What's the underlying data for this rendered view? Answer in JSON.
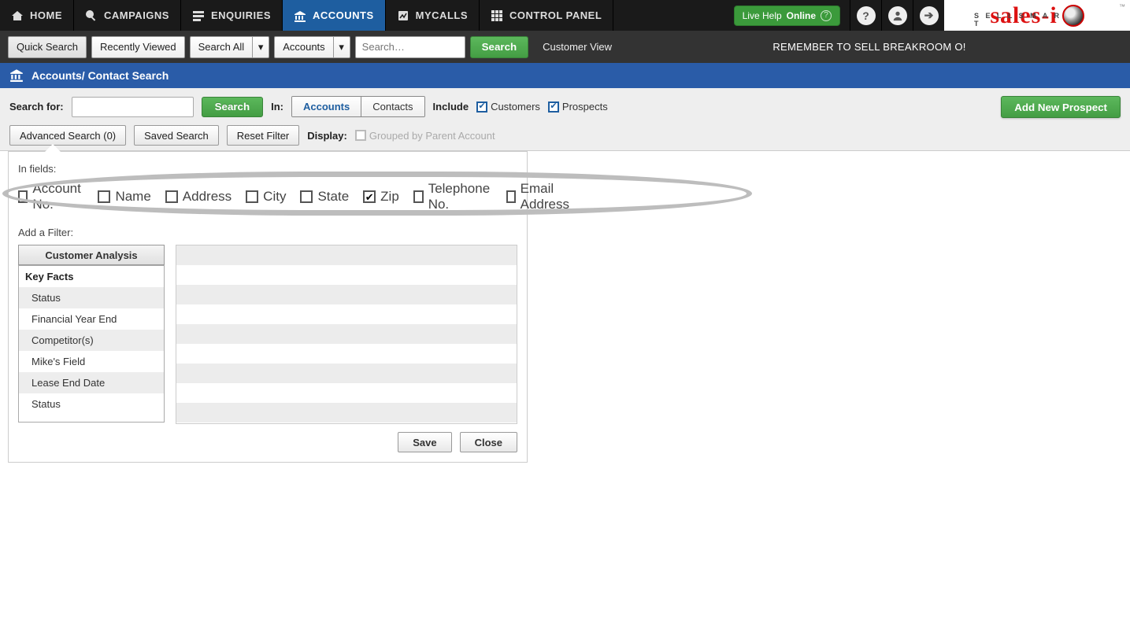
{
  "nav": {
    "items": [
      {
        "label": "HOME",
        "icon": "home"
      },
      {
        "label": "CAMPAIGNS",
        "icon": "campaign"
      },
      {
        "label": "ENQUIRIES",
        "icon": "enquiry"
      },
      {
        "label": "ACCOUNTS",
        "icon": "bank",
        "active": true
      },
      {
        "label": "MYCALLS",
        "icon": "calls"
      },
      {
        "label": "CONTROL PANEL",
        "icon": "grid"
      }
    ],
    "live_help_prefix": "Live Help ",
    "live_help_status": "Online"
  },
  "logo": {
    "brand": "sales-i",
    "tag": "S E L L   S M A R T",
    "tm": "™"
  },
  "quickbar": {
    "quick_search": "Quick Search",
    "recently_viewed": "Recently Viewed",
    "search_all": "Search All",
    "accounts": "Accounts",
    "placeholder": "Search…",
    "search_btn": "Search",
    "customer_view": "Customer View",
    "marquee": "REMEMBER TO SELL BREAKROOM O!"
  },
  "page_header": "Accounts/ Contact Search",
  "panel": {
    "search_for": "Search for:",
    "search_btn": "Search",
    "in": "In:",
    "tab_accounts": "Accounts",
    "tab_contacts": "Contacts",
    "include": "Include",
    "customers": "Customers",
    "prospects": "Prospects",
    "advanced": "Advanced Search (0)",
    "saved": "Saved Search",
    "reset": "Reset Filter",
    "display": "Display:",
    "grouped": "Grouped by Parent Account",
    "add_prospect": "Add New Prospect"
  },
  "adv": {
    "in_fields": "In fields:",
    "fields": [
      {
        "label": "Account No.",
        "checked": false
      },
      {
        "label": "Name",
        "checked": false
      },
      {
        "label": "Address",
        "checked": false
      },
      {
        "label": "City",
        "checked": false
      },
      {
        "label": "State",
        "checked": false
      },
      {
        "label": "Zip",
        "checked": true
      },
      {
        "label": "Telephone No.",
        "checked": false
      },
      {
        "label": "Email Address",
        "checked": false
      }
    ],
    "add_filter": "Add a Filter:",
    "customer_analysis": "Customer Analysis",
    "key_facts_header": "Key Facts",
    "key_facts": [
      "Status",
      "Financial Year End",
      "Competitor(s)",
      "Mike's Field",
      "Lease End Date",
      "Status"
    ],
    "save": "Save",
    "close": "Close"
  }
}
